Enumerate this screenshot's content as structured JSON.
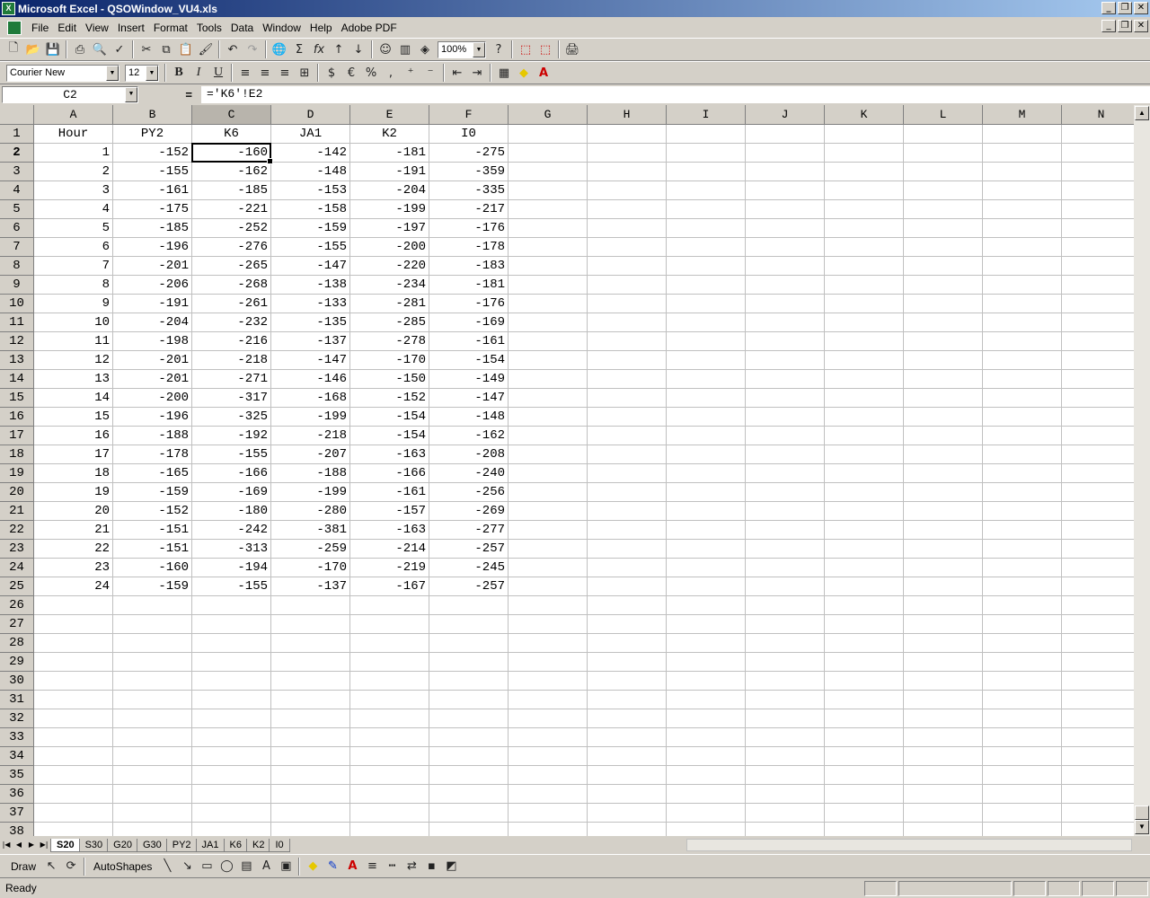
{
  "window": {
    "title": "Microsoft Excel - QSOWindow_VU4.xls"
  },
  "menu": [
    "File",
    "Edit",
    "View",
    "Insert",
    "Format",
    "Tools",
    "Data",
    "Window",
    "Help",
    "Adobe PDF"
  ],
  "toolbar": {
    "zoom": "100%",
    "font_name": "Courier New",
    "font_size": "12"
  },
  "formula_bar": {
    "name_box": "C2",
    "equals": "=",
    "formula": "='K6'!E2"
  },
  "columns": [
    "A",
    "B",
    "C",
    "D",
    "E",
    "F",
    "G",
    "H",
    "I",
    "J",
    "K",
    "L",
    "M",
    "N"
  ],
  "active_cell": "C2",
  "sheet": {
    "headers": [
      "Hour",
      "PY2",
      "K6",
      "JA1",
      "K2",
      "I0"
    ],
    "rows": [
      [
        "1",
        "-152",
        "-160",
        "-142",
        "-181",
        "-275"
      ],
      [
        "2",
        "-155",
        "-162",
        "-148",
        "-191",
        "-359"
      ],
      [
        "3",
        "-161",
        "-185",
        "-153",
        "-204",
        "-335"
      ],
      [
        "4",
        "-175",
        "-221",
        "-158",
        "-199",
        "-217"
      ],
      [
        "5",
        "-185",
        "-252",
        "-159",
        "-197",
        "-176"
      ],
      [
        "6",
        "-196",
        "-276",
        "-155",
        "-200",
        "-178"
      ],
      [
        "7",
        "-201",
        "-265",
        "-147",
        "-220",
        "-183"
      ],
      [
        "8",
        "-206",
        "-268",
        "-138",
        "-234",
        "-181"
      ],
      [
        "9",
        "-191",
        "-261",
        "-133",
        "-281",
        "-176"
      ],
      [
        "10",
        "-204",
        "-232",
        "-135",
        "-285",
        "-169"
      ],
      [
        "11",
        "-198",
        "-216",
        "-137",
        "-278",
        "-161"
      ],
      [
        "12",
        "-201",
        "-218",
        "-147",
        "-170",
        "-154"
      ],
      [
        "13",
        "-201",
        "-271",
        "-146",
        "-150",
        "-149"
      ],
      [
        "14",
        "-200",
        "-317",
        "-168",
        "-152",
        "-147"
      ],
      [
        "15",
        "-196",
        "-325",
        "-199",
        "-154",
        "-148"
      ],
      [
        "16",
        "-188",
        "-192",
        "-218",
        "-154",
        "-162"
      ],
      [
        "17",
        "-178",
        "-155",
        "-207",
        "-163",
        "-208"
      ],
      [
        "18",
        "-165",
        "-166",
        "-188",
        "-166",
        "-240"
      ],
      [
        "19",
        "-159",
        "-169",
        "-199",
        "-161",
        "-256"
      ],
      [
        "20",
        "-152",
        "-180",
        "-280",
        "-157",
        "-269"
      ],
      [
        "21",
        "-151",
        "-242",
        "-381",
        "-163",
        "-277"
      ],
      [
        "22",
        "-151",
        "-313",
        "-259",
        "-214",
        "-257"
      ],
      [
        "23",
        "-160",
        "-194",
        "-170",
        "-219",
        "-245"
      ],
      [
        "24",
        "-159",
        "-155",
        "-137",
        "-167",
        "-257"
      ]
    ],
    "total_row_numbers": 38
  },
  "tabs": [
    "S20",
    "S30",
    "G20",
    "G30",
    "PY2",
    "JA1",
    "K6",
    "K2",
    "I0"
  ],
  "active_tab": "S20",
  "drawing": {
    "draw_label": "Draw",
    "autoshapes_label": "AutoShapes"
  },
  "status": {
    "text": "Ready"
  }
}
